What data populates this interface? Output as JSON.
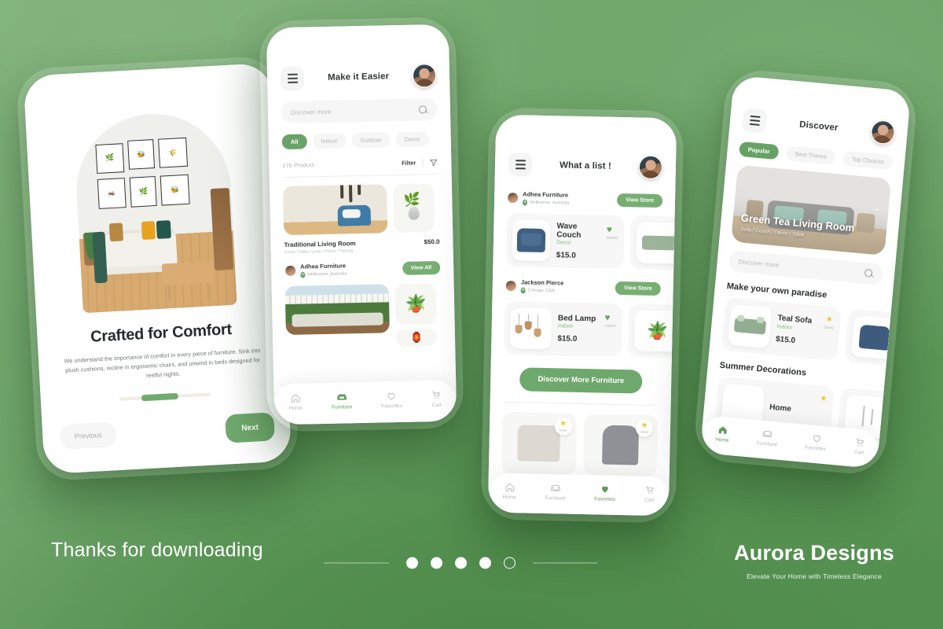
{
  "theme": {
    "bg_green_light": "#77ad72",
    "bg_green_dark": "#54904f",
    "accent": "#6fa86c",
    "muted": "#b3b9b5",
    "star": "#f5c330"
  },
  "footer": {
    "thanks": "Thanks for downloading",
    "brand_name": "Aurora Designs",
    "brand_tagline": "Elevate Your Home with Timeless Elegance",
    "dots": [
      "filled",
      "filled",
      "filled",
      "filled",
      "hollow"
    ]
  },
  "screen1": {
    "name": "onboarding",
    "heading": "Crafted for Comfort",
    "body": "We understand the importance of comfort in every piece of furniture. Sink into plush cushions, recline in ergonomic chairs, and unwind in beds designed for restful nights.",
    "prev_label": "Previous",
    "next_label": "Next"
  },
  "screen2": {
    "name": "furniture-list",
    "title": "Make it Easier",
    "search_placeholder": "Discover more",
    "chips": [
      "All",
      "Indoor",
      "Outdoor",
      "Decor"
    ],
    "active_chip": "All",
    "count_label": "176 Product",
    "filter_label": "Filter",
    "product": {
      "name": "Traditional Living Room",
      "tags": "Couch / Table / Lamp / Plants / Painting",
      "price": "$50.0"
    },
    "seller": {
      "name": "Adhea Furniture",
      "location": "Melbourne, Australia",
      "action": "View All"
    },
    "nav": [
      {
        "label": "Home",
        "icon": "home-icon",
        "active": false
      },
      {
        "label": "Furniture",
        "icon": "sofa-icon",
        "active": true
      },
      {
        "label": "Favorites",
        "icon": "heart-icon",
        "active": false
      },
      {
        "label": "Cart",
        "icon": "cart-icon",
        "active": false
      }
    ]
  },
  "screen3": {
    "name": "favorites-list",
    "title": "What a list !",
    "sellers": [
      {
        "name": "Adhea Furniture",
        "location": "Melbourne, Australia",
        "action": "View Store"
      },
      {
        "name": "Jackson Pierce",
        "location": "Chicago, USA",
        "action": "View Store"
      }
    ],
    "products": [
      {
        "name": "Wave Couch",
        "category": "Decor",
        "price": "$15.0",
        "fav_label": "Added"
      },
      {
        "name": "Bed Lamp",
        "category": "Indoor",
        "price": "$15.0",
        "fav_label": "Added"
      }
    ],
    "cta": "Discover More Furniture",
    "rated_badges": [
      "Great",
      "Great"
    ],
    "nav": [
      {
        "label": "Home",
        "icon": "home-icon",
        "active": false
      },
      {
        "label": "Furniture",
        "icon": "sofa-icon",
        "active": false
      },
      {
        "label": "Favorites",
        "icon": "heart-icon",
        "active": true
      },
      {
        "label": "Cart",
        "icon": "cart-icon",
        "active": false
      }
    ]
  },
  "screen4": {
    "name": "discover",
    "title": "Discover",
    "chips": [
      "Popular",
      "Best Theme",
      "Top Choices"
    ],
    "active_chip": "Popular",
    "banner": {
      "title": "Green Tea Living Room",
      "subtitle": "Sofa  /  Couch  /  Decor  /  Table"
    },
    "search_placeholder": "Discover more",
    "section1_title": "Make your own paradise",
    "section2_title": "Summer Decorations",
    "products": [
      {
        "name": "Teal Sofa",
        "category": "Indoor",
        "price": "$15.0",
        "badge": "Great"
      },
      {
        "name": "Home",
        "category": "",
        "price": "",
        "badge": "Great"
      }
    ],
    "nav": [
      {
        "label": "Home",
        "icon": "home-icon",
        "active": true
      },
      {
        "label": "Furniture",
        "icon": "sofa-icon",
        "active": false
      },
      {
        "label": "Favorites",
        "icon": "heart-icon",
        "active": false
      },
      {
        "label": "Cart",
        "icon": "cart-icon",
        "active": false
      }
    ]
  }
}
